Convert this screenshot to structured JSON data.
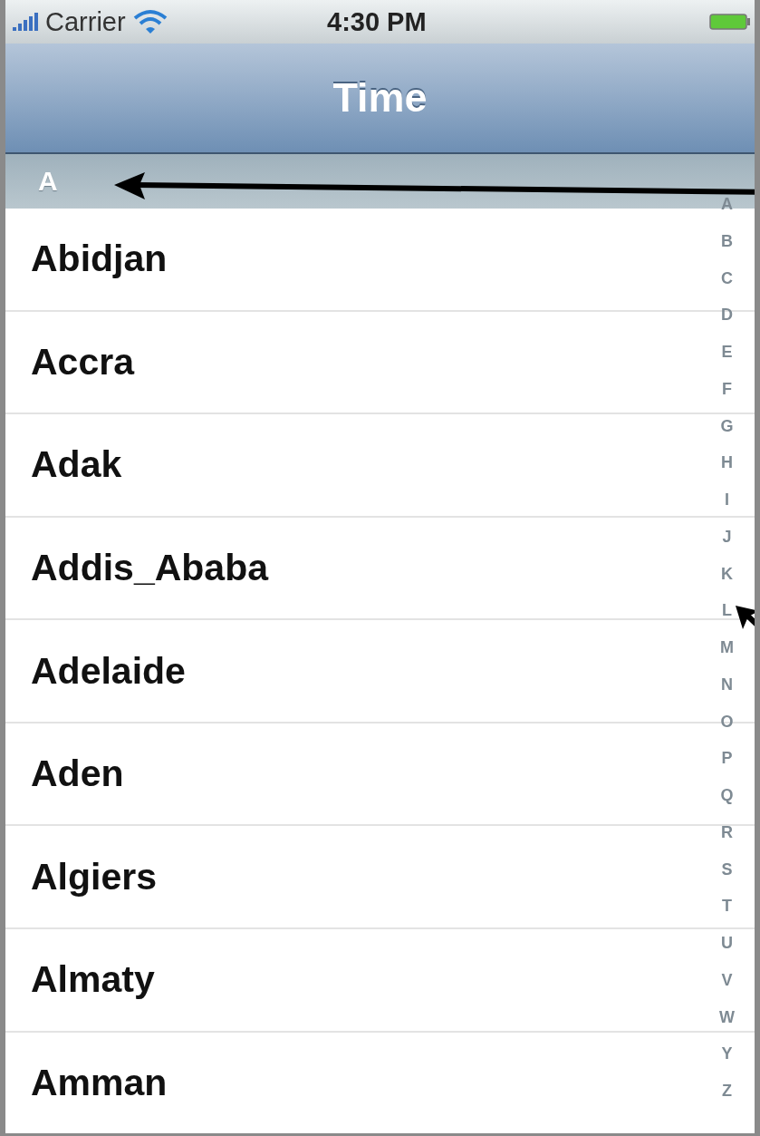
{
  "status_bar": {
    "carrier": "Carrier",
    "time": "4:30 PM"
  },
  "nav_bar": {
    "title": "Time"
  },
  "section": {
    "header": "A",
    "rows": [
      {
        "label": "Abidjan"
      },
      {
        "label": "Accra"
      },
      {
        "label": "Adak"
      },
      {
        "label": "Addis_Ababa"
      },
      {
        "label": "Adelaide"
      },
      {
        "label": "Aden"
      },
      {
        "label": "Algiers"
      },
      {
        "label": "Almaty"
      },
      {
        "label": "Amman"
      }
    ]
  },
  "index": [
    "A",
    "B",
    "C",
    "D",
    "E",
    "F",
    "G",
    "H",
    "I",
    "J",
    "K",
    "L",
    "M",
    "N",
    "O",
    "P",
    "Q",
    "R",
    "S",
    "T",
    "U",
    "V",
    "W",
    "Y",
    "Z"
  ]
}
